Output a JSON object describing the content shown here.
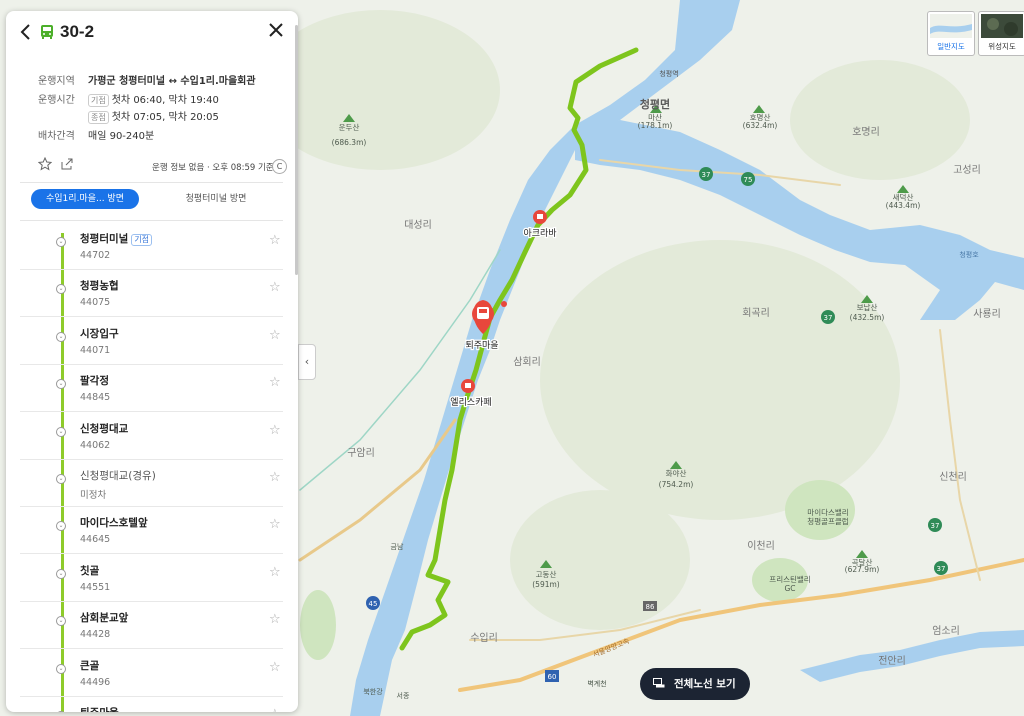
{
  "route": {
    "number": "30-2",
    "info": [
      {
        "label": "운행지역",
        "value": "가평군  청평터미널 ↔ 수입1리.마을회관"
      },
      {
        "label": "운행시간",
        "tag": "기점",
        "value": "첫차 06:40, 막차 19:40"
      },
      {
        "label": "",
        "tag": "종점",
        "value": "첫차 07:05, 막차 20:05"
      },
      {
        "label": "배차간격",
        "value": "매일 90-240분"
      }
    ],
    "status": "운행 정보 없음 · 오후 08:59 기준",
    "tabs": [
      "수입1리.마을...  방면",
      "청평터미널 방면"
    ]
  },
  "stops": [
    {
      "name": "청평터미널",
      "tag": "기점",
      "id": "44702"
    },
    {
      "name": "청평농협",
      "id": "44075"
    },
    {
      "name": "시장입구",
      "id": "44071"
    },
    {
      "name": "팔각정",
      "id": "44845"
    },
    {
      "name": "신청평대교",
      "id": "44062"
    },
    {
      "name": "신청평대교(경유)",
      "id": "미정차",
      "light": true
    },
    {
      "name": "마이다스호텔앞",
      "id": "44645"
    },
    {
      "name": "칫골",
      "id": "44551"
    },
    {
      "name": "삼회분교앞",
      "id": "44428"
    },
    {
      "name": "큰골",
      "id": "44496"
    },
    {
      "name": "퇴주마을",
      "id": ""
    }
  ],
  "map": {
    "types": [
      "일반지도",
      "위성지도"
    ],
    "full_route_button": "전체노선 보기",
    "places": [
      {
        "name": "청평면",
        "kind": "town"
      },
      {
        "name": "청평역",
        "kind": "station"
      },
      {
        "name": "마산",
        "elev": "(178.1m)"
      },
      {
        "name": "호명산",
        "elev": "(632.4m)"
      },
      {
        "name": "운두산",
        "elev": "(686.3m)"
      },
      {
        "name": "새덕산",
        "elev": "(443.4m)"
      },
      {
        "name": "보납산",
        "elev": "(432.5m)"
      },
      {
        "name": "화야산",
        "elev": "(754.2m)"
      },
      {
        "name": "곡달산",
        "elev": "(627.9m)"
      },
      {
        "name": "고동산",
        "elev": "(591m)"
      },
      {
        "name": "대성리"
      },
      {
        "name": "구암리"
      },
      {
        "name": "삼회리"
      },
      {
        "name": "회곡리"
      },
      {
        "name": "사룡리"
      },
      {
        "name": "고성리"
      },
      {
        "name": "이천리"
      },
      {
        "name": "신천리"
      },
      {
        "name": "수입리"
      },
      {
        "name": "엄소리"
      },
      {
        "name": "전안리"
      },
      {
        "name": "호명리"
      },
      {
        "name": "마이다스밸리 청평골프클럽"
      },
      {
        "name": "프리스틴밸리 GC"
      },
      {
        "name": "서울양양고속"
      },
      {
        "name": "아크라바"
      },
      {
        "name": "퇴주마을"
      },
      {
        "name": "엘리스카페"
      },
      {
        "name": "금남"
      },
      {
        "name": "북한강"
      },
      {
        "name": "서종"
      },
      {
        "name": "벽계천"
      },
      {
        "name": "청평호"
      }
    ],
    "road_shields": [
      "37",
      "75",
      "37",
      "37",
      "37",
      "45",
      "86",
      "60"
    ]
  },
  "colors": {
    "river": "#a8cfee",
    "route": "#7ec51d",
    "accent": "#1a73e8",
    "poi": "#e8473c"
  }
}
